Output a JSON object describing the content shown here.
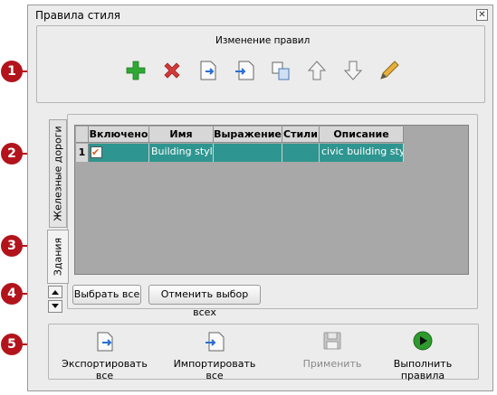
{
  "window": {
    "title": "Правила стиля",
    "close_glyph": "✕"
  },
  "toolbar": {
    "group_label": "Изменение правил",
    "icons": [
      "add-icon",
      "delete-icon",
      "export-rule-icon",
      "import-rule-icon",
      "copy-rule-icon",
      "move-up-icon",
      "move-down-icon",
      "edit-icon"
    ]
  },
  "tabs": [
    {
      "label": "Железные дороги"
    },
    {
      "label": "Здания"
    }
  ],
  "table": {
    "columns": [
      "Включено",
      "Имя",
      "Выражение",
      "Стили",
      "Описание"
    ],
    "rows": [
      {
        "index": "1",
        "enabled_glyph": "✔",
        "name": "Building styles",
        "expression": "",
        "styles": "",
        "description": "civic building styles"
      }
    ]
  },
  "select_all_label": "Выбрать все",
  "deselect_all_label": "Отменить выбор всех",
  "bottom": {
    "export_label": "Экспортировать все",
    "import_label": "Импортировать все",
    "apply_label": "Применить",
    "run_label": "Выполнить правила"
  },
  "callouts": [
    "1",
    "2",
    "3",
    "4",
    "5"
  ],
  "colors": {
    "selection": "#2f9590",
    "callout": "#b3131b",
    "add": "#2fa834",
    "delete": "#d23a3a",
    "run": "#2e9a2e"
  }
}
